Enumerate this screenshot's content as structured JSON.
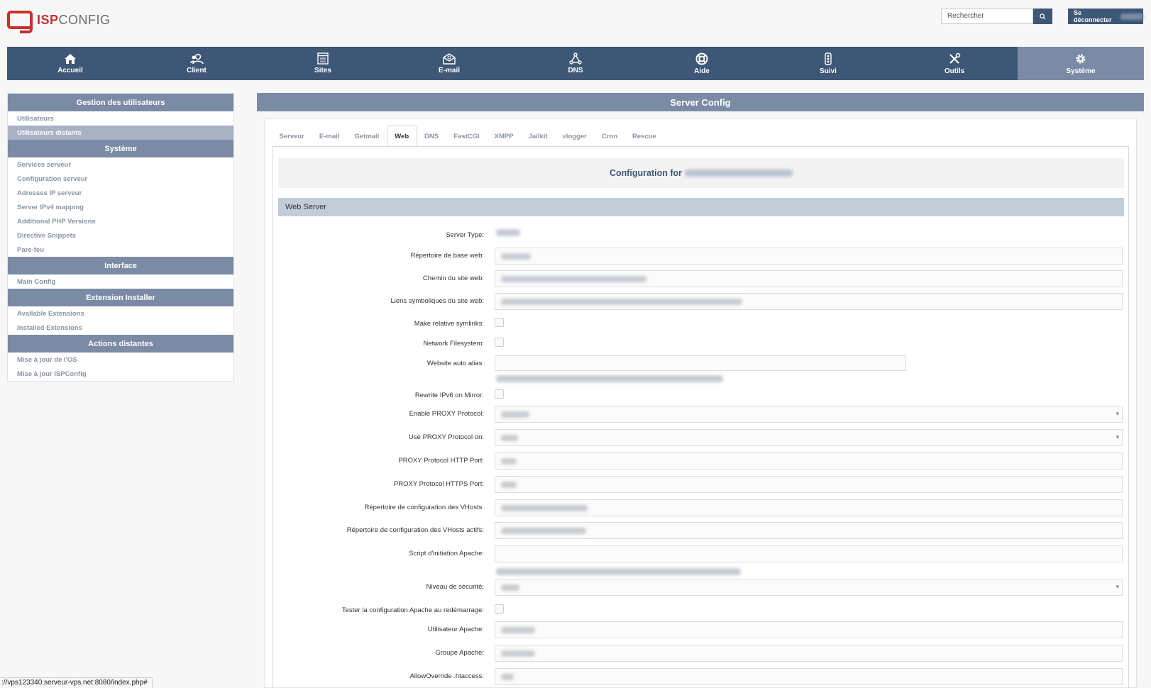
{
  "app": {
    "logo_isp": "ISP",
    "logo_config": "CONFIG"
  },
  "header": {
    "search_placeholder": "Rechercher",
    "logout_label": "Se déconnecter"
  },
  "nav": {
    "items": [
      {
        "label": "Accueil",
        "icon": "home-icon"
      },
      {
        "label": "Client",
        "icon": "users-icon"
      },
      {
        "label": "Sites",
        "icon": "sites-icon"
      },
      {
        "label": "E-mail",
        "icon": "email-icon"
      },
      {
        "label": "DNS",
        "icon": "dns-icon"
      },
      {
        "label": "Aide",
        "icon": "help-icon"
      },
      {
        "label": "Suivi",
        "icon": "monitor-icon"
      },
      {
        "label": "Outils",
        "icon": "tools-icon"
      },
      {
        "label": "Système",
        "icon": "gear-icon"
      }
    ],
    "active": "Système"
  },
  "sidebar": {
    "sections": [
      {
        "title": "Gestion des utilisateurs",
        "items": [
          "Utilisateurs",
          "Utilisateurs distants"
        ]
      },
      {
        "title": "Système",
        "items": [
          "Services serveur",
          "Configuration serveur",
          "Adresses IP serveur",
          "Server IPv4 mapping",
          "Additional PHP Versions",
          "Directive Snippets",
          "Pare-feu"
        ]
      },
      {
        "title": "Interface",
        "items": [
          "Main Config"
        ]
      },
      {
        "title": "Extension Installer",
        "items": [
          "Available Extensions",
          "Installed Extensions"
        ]
      },
      {
        "title": "Actions distantes",
        "items": [
          "Mise à jour de l'OS",
          "Mise à jour ISPConfig"
        ]
      }
    ],
    "active_item": "Utilisateurs distants"
  },
  "main": {
    "title": "Server Config",
    "tabs": [
      "Serveur",
      "E-mail",
      "Getmail",
      "Web",
      "DNS",
      "FastCGI",
      "XMPP",
      "Jailkit",
      "vlogger",
      "Cron",
      "Rescue"
    ],
    "active_tab": "Web",
    "config_for_label": "Configuration for",
    "section_title": "Web Server",
    "fields": [
      {
        "label": "Server Type:"
      },
      {
        "label": "Répertoire de base web:"
      },
      {
        "label": "Chemin du site web:"
      },
      {
        "label": "Liens symboliques du site web:"
      },
      {
        "label": "Make relative symlinks:"
      },
      {
        "label": "Network Filesystem:"
      },
      {
        "label": "Website auto alias:"
      },
      {
        "label": "Rewrite IPv6 on Mirror:"
      },
      {
        "label": "Enable PROXY Protocol:"
      },
      {
        "label": "Use PROXY Protocol on:"
      },
      {
        "label": "PROXY Protocol HTTP Port:"
      },
      {
        "label": "PROXY Protocol HTTPS Port:"
      },
      {
        "label": "Répertoire de configuration des VHosts:"
      },
      {
        "label": "Répertoire de configuration des VHosts actifs:"
      },
      {
        "label": "Script d'initiation Apache:"
      },
      {
        "label": "Niveau de sécurité:"
      },
      {
        "label": "Tester la configuration Apache au redémarrage:"
      },
      {
        "label": "Utilisateur Apache:"
      },
      {
        "label": "Groupe Apache:"
      },
      {
        "label": "AllowOverride .htaccess:"
      }
    ]
  },
  "statusbar": {
    "url": "://vps123340.serveur-vps.net:8080/index.php#"
  }
}
